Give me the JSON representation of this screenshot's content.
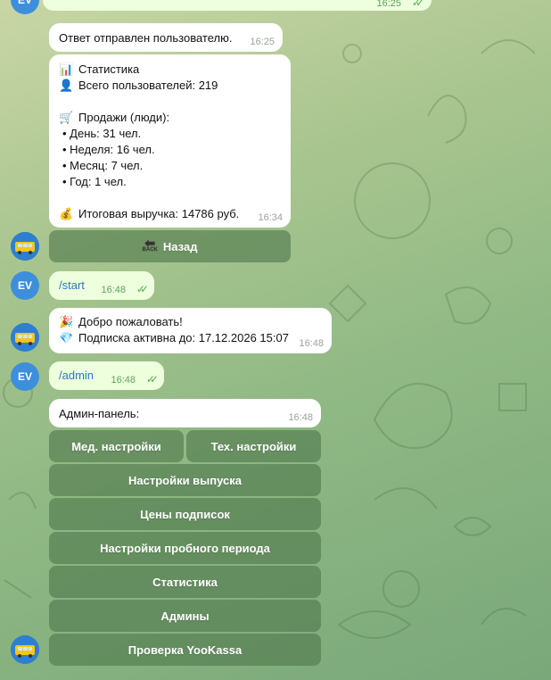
{
  "avatars": {
    "user_initials": "EV"
  },
  "top_partial": {
    "time": "16:25"
  },
  "reply_sent": {
    "text": "Ответ отправлен пользователю.",
    "time": "16:25"
  },
  "stats": {
    "title": "Статистика",
    "total_users": "Всего пользователей: 219",
    "sales_heading": "Продажи (люди):",
    "day": "• День: 31 чел.",
    "week": "• Неделя: 16 чел.",
    "month": "• Месяц: 7 чел.",
    "year": "• Год: 1 чел.",
    "revenue": "Итоговая выручка: 14786 руб.",
    "time": "16:34"
  },
  "back_button": {
    "label": "Назад",
    "icon_text": "BACK"
  },
  "start_msg": {
    "text": "/start",
    "time": "16:48"
  },
  "welcome": {
    "line1": "Добро пожаловать!",
    "line2": "Подписка активна до: 17.12.2026 15:07",
    "time": "16:48"
  },
  "admin_msg": {
    "text": "/admin",
    "time": "16:48"
  },
  "admin_panel": {
    "text": "Админ-панель:",
    "time": "16:48"
  },
  "keyboard": {
    "med_settings": "Мед. настройки",
    "tech_settings": "Тех. настройки",
    "release_settings": "Настройки выпуска",
    "subscription_prices": "Цены подписок",
    "trial_settings": "Настройки пробного периода",
    "statistics": "Статистика",
    "admins": "Админы",
    "yookassa_check": "Проверка YooKassa"
  },
  "colors": {
    "incoming": "#ffffff",
    "outgoing": "#eeffde",
    "link": "#2a7ac2",
    "keyboard_button": "#4f784c",
    "avatar_user": "#3d8fdc"
  }
}
